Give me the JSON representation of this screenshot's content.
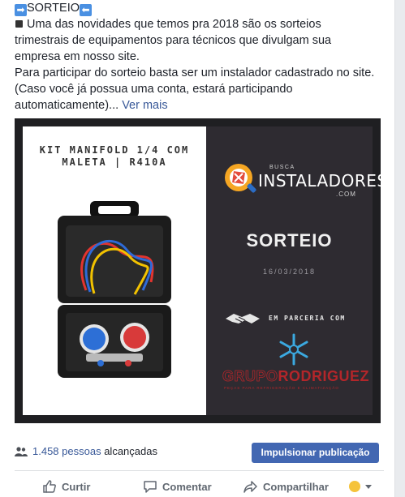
{
  "post": {
    "title": "SORTEIO",
    "line1": "Uma das novidades que temos pra 2018 são os sorteios",
    "line2": "trimestrais de equipamentos para técnicos que divulgam sua",
    "line3": "empresa em nosso site.",
    "line4": "Para participar do sorteio basta ser um instalador cadastrado no site.",
    "line5": "(Caso você já possua uma conta, estará participando",
    "line6": "automaticamente)...",
    "see_more": "Ver mais"
  },
  "image": {
    "kit_line1": "KIT MANIFOLD 1/4 COM",
    "kit_line2": "MALETA | R410A",
    "logo_busca": "BUSCA",
    "logo_instaladores": "INSTALADORES",
    "logo_com": ".COM",
    "sorteio": "SORTEIO",
    "date": "16/03/2018",
    "parceria": "EM PARCERIA COM",
    "grupo_part1": "GRUPO",
    "grupo_part2": "RODRIGUEZ",
    "grupo_tagline": "PEÇAS PARA REFRIGERAÇÃO E CLIMATIZAÇÃO"
  },
  "reach": {
    "count_link": "1.458 pessoas",
    "suffix": "alcançadas",
    "boost_label": "Impulsionar publicação"
  },
  "actions": {
    "like": "Curtir",
    "comment": "Comentar",
    "share": "Compartilhar"
  },
  "colors": {
    "link": "#385898",
    "button": "#4267b2",
    "image_bg": "#2e2b31",
    "brand_red": "#b2262a"
  }
}
